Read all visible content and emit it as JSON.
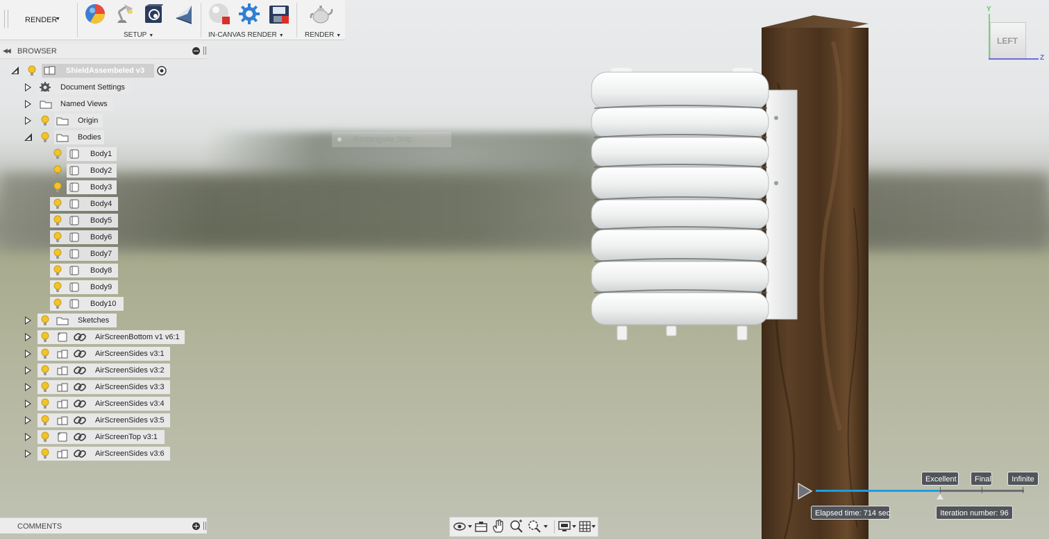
{
  "toolbar": {
    "workspace_label": "RENDER",
    "groups": [
      {
        "label": "SETUP"
      },
      {
        "label": "IN-CANVAS RENDER"
      },
      {
        "label": "RENDER"
      }
    ]
  },
  "browser": {
    "title": "BROWSER",
    "root": "ShieldAssembeled v3",
    "items": [
      {
        "label": "Document Settings"
      },
      {
        "label": "Named Views"
      },
      {
        "label": "Origin"
      },
      {
        "label": "Bodies"
      },
      {
        "label": "Body1"
      },
      {
        "label": "Body2"
      },
      {
        "label": "Body3"
      },
      {
        "label": "Body4"
      },
      {
        "label": "Body5"
      },
      {
        "label": "Body6"
      },
      {
        "label": "Body7"
      },
      {
        "label": "Body8"
      },
      {
        "label": "Body9"
      },
      {
        "label": "Body10"
      },
      {
        "label": "Sketches"
      },
      {
        "label": "AirScreenBottom v1 v6:1"
      },
      {
        "label": "AirScreenSides v3:1"
      },
      {
        "label": "AirScreenSides v3:2"
      },
      {
        "label": "AirScreenSides v3:3"
      },
      {
        "label": "AirScreenSides v3:4"
      },
      {
        "label": "AirScreenSides v3:5"
      },
      {
        "label": "AirScreenTop v3:1"
      },
      {
        "label": "AirScreenSides v3:6"
      }
    ]
  },
  "snip": {
    "label": "Rectangular Snip"
  },
  "comments": {
    "title": "COMMENTS"
  },
  "viewcube": {
    "face": "LEFT",
    "y_axis": "Y",
    "z_axis": "Z"
  },
  "render": {
    "quality_labels": [
      "Excellent",
      "Final",
      "Infinite"
    ],
    "elapsed": "Elapsed time: 714 sec",
    "iteration": "Iteration number: 96",
    "progress_fraction": 0.6
  },
  "colors": {
    "accent": "#1b9de2",
    "bulb": "#f3c32b"
  }
}
